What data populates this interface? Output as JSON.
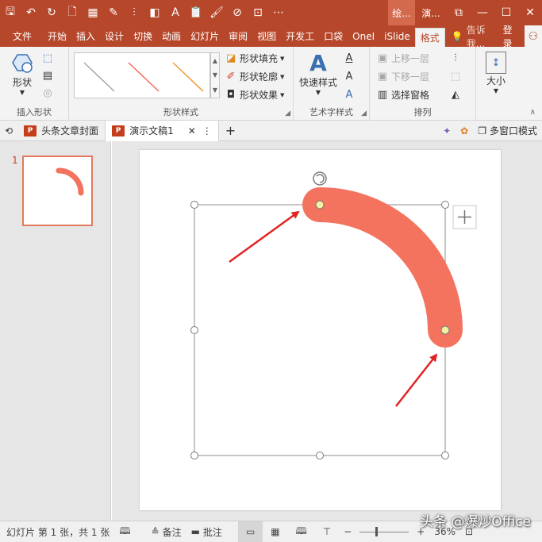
{
  "titlebar": {
    "qat": [
      {
        "name": "save-icon",
        "glyph": "🖫"
      },
      {
        "name": "undo-icon",
        "glyph": "↶"
      },
      {
        "name": "redo-icon",
        "glyph": "↻"
      },
      {
        "name": "new-file-icon",
        "glyph": "🗋"
      },
      {
        "name": "grid-icon",
        "glyph": "▦"
      },
      {
        "name": "eyedropper-icon",
        "glyph": "✎"
      },
      {
        "name": "align-icon",
        "glyph": "⫶"
      },
      {
        "name": "fill-color-icon",
        "glyph": "◧"
      },
      {
        "name": "font-color-icon",
        "glyph": "A"
      },
      {
        "name": "paste-icon",
        "glyph": "📋"
      },
      {
        "name": "format-painter-icon",
        "glyph": "🖌"
      },
      {
        "name": "no-sign-icon",
        "glyph": "⊘"
      },
      {
        "name": "select-icon",
        "glyph": "⊡"
      },
      {
        "name": "more-icon",
        "glyph": "⋯"
      }
    ],
    "context_tab": "绘...",
    "doc_tab": "演...",
    "window": {
      "restore": "⧉",
      "minimize": "—",
      "maximize": "☐",
      "close": "✕"
    },
    "colors": {
      "bar": "#b7472a"
    }
  },
  "tabs": {
    "file": "文件",
    "items": [
      "开始",
      "插入",
      "设计",
      "切换",
      "动画",
      "幻灯片",
      "审阅",
      "视图",
      "开发工",
      "口袋",
      "OneI",
      "iSlide"
    ],
    "active": "格式",
    "tell": "告诉我...",
    "login": "登录"
  },
  "ribbon": {
    "insert_shapes": {
      "big": "形状",
      "label": "插入形状"
    },
    "shape_styles": {
      "fill": "形状填充",
      "outline": "形状轮廓",
      "effects": "形状效果",
      "label": "形状样式"
    },
    "wordart": {
      "quick": "快速样式",
      "label": "艺术字样式"
    },
    "arrange": {
      "up": "上移一层",
      "down": "下移一层",
      "pane": "选择窗格",
      "label": "排列"
    },
    "size": {
      "big": "大小"
    },
    "gallery_colors": [
      "#a6a6a6",
      "#f4695a",
      "#f29b38"
    ]
  },
  "docstrip": {
    "tab1": "头条文章封面",
    "tab2": "演示文稿1",
    "multiwin": "多窗口模式"
  },
  "thumbs": {
    "num": "1"
  },
  "canvas": {
    "arc_color": "#f4735f",
    "arrow_color": "#e02424"
  },
  "status": {
    "slide_info": "幻灯片 第 1 张，共 1 张",
    "notes": "备注",
    "comments": "批注",
    "zoom": "36%"
  },
  "watermark": "头条 @爆炒Office"
}
